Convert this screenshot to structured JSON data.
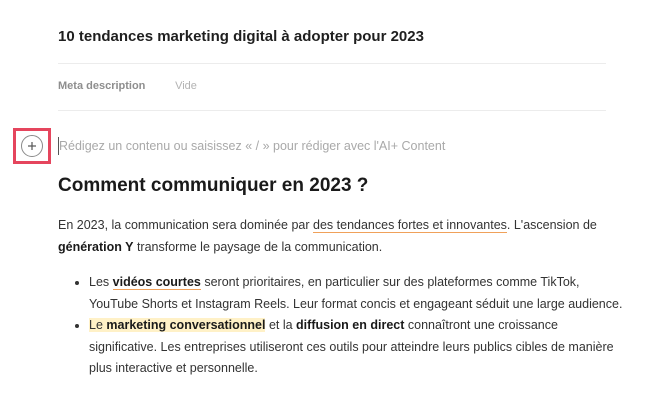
{
  "document": {
    "title": "10 tendances marketing digital à adopter pour 2023"
  },
  "meta": {
    "label": "Meta description",
    "value": "Vide"
  },
  "editor": {
    "placeholder": "Rédigez un contenu ou saisissez « / » pour rédiger avec l'AI+ Content",
    "add_icon": "plus-icon"
  },
  "content": {
    "heading": "Comment communiquer en 2023 ?",
    "paragraph": {
      "p1": "En 2023, la communication sera dominée par ",
      "link1": "des tendances fortes et innovantes",
      "p2": ". L'ascension de ",
      "bold1": "génération Y",
      "p3": " transforme le paysage de la communication."
    },
    "bullets": [
      {
        "a": "Les ",
        "b": "vidéos courtes",
        "c": " seront prioritaires, en particulier sur des plateformes comme TikTok, YouTube Shorts et Instagram Reels. Leur format concis et engageant séduit une large audience."
      },
      {
        "a": "Le ",
        "b": "marketing conversationnel",
        "c": " et la ",
        "d": "diffusion en direct",
        "e": " connaîtront une croissance significative. Les entreprises utiliseront ces outils pour atteindre leurs publics cibles de manière plus interactive et personnelle."
      }
    ]
  },
  "colors": {
    "highlight_frame": "#e5455d",
    "underline": "#f0a15a",
    "highlight_bg": "#fff1c7"
  }
}
